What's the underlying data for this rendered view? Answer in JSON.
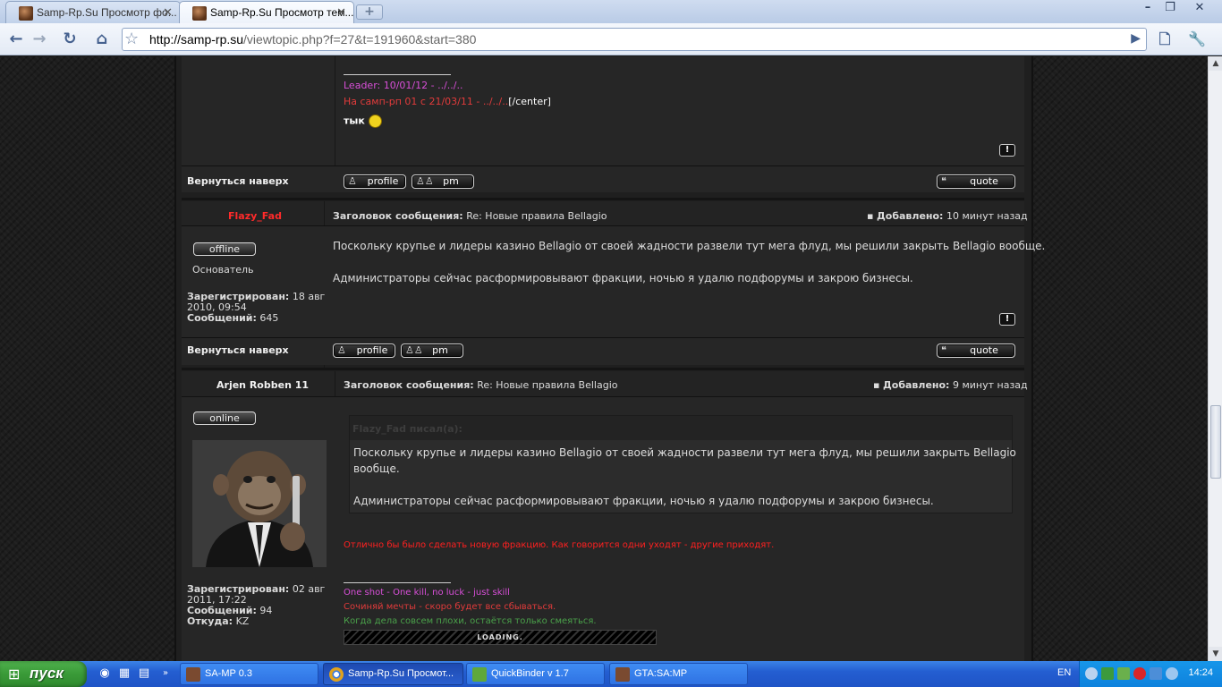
{
  "browser": {
    "tabs": [
      {
        "title": "Samp-Rp.Su Просмотр фо..."
      },
      {
        "title": "Samp-Rp.Su Просмотр тем..."
      }
    ],
    "new_tab_symbol": "+",
    "window_buttons": [
      "–",
      "❐",
      "✕"
    ],
    "url_host": "http://samp-rp.su",
    "url_path": "/viewtopic.php?f=27&t=191960&start=380",
    "icons": [
      "back-icon",
      "forward-icon",
      "reload-icon",
      "home-icon",
      "bookmark-star-icon",
      "go-icon",
      "page-menu-icon",
      "wrench-icon"
    ]
  },
  "post_top": {
    "sig_line1": "Leader: 10/01/12 - ../../..",
    "sig_line2_red": "На самп-рп 01 с 21/03/11 - ../../..",
    "sig_line2_white": "[/center]",
    "sig_line3": "тык",
    "back_to_top": "Вернуться наверх",
    "profile_label": "profile",
    "pm_label": "pm",
    "quote_label": "quote",
    "report_symbol": "!"
  },
  "post1": {
    "author": "Flazy_Fad",
    "author_color": "#ff2a2a",
    "status": "offline",
    "rank": "Основатель",
    "registered_label": "Зарегистрирован:",
    "registered_value": "18 авг",
    "registered_value2": "2010, 09:54",
    "posts_label": "Сообщений:",
    "posts_value": "645",
    "subject_label": "Заголовок сообщения:",
    "subject_value": "Re: Новые правила Bellagio",
    "added_label": "Добавлено:",
    "added_value": "10 минут назад",
    "body_p1": "Поскольку крупье и лидеры казино Bellagio от своей жадности развели тут мега флуд, мы решили закрыть Bellagio вообще.",
    "body_p2": "Администраторы сейчас расформировывают фракции, ночью я удалю подфорумы и закрою бизнесы.",
    "back_to_top": "Вернуться наверх",
    "profile_label": "profile",
    "pm_label": "pm",
    "quote_label": "quote",
    "report_symbol": "!"
  },
  "post2": {
    "author": "Arjen Robben 11",
    "status": "online",
    "registered_label": "Зарегистрирован:",
    "registered_value": "02 авг",
    "registered_value2": "2011, 17:22",
    "posts_label": "Сообщений:",
    "posts_value": "94",
    "from_label": "Откуда:",
    "from_value": "KZ",
    "subject_label": "Заголовок сообщения:",
    "subject_value": "Re: Новые правила Bellagio",
    "added_label": "Добавлено:",
    "added_value": "9 минут назад",
    "quote_author": "Flazy_Fad писал(а):",
    "quote_p1a": "Поскольку крупье и лидеры казино Bellagio от своей жадности развели тут мега флуд, мы решили закрыть Bellagio",
    "quote_p1b": "вообще.",
    "quote_p2": "Администраторы сейчас расформировывают фракции, ночью я удалю подфорумы и закрою бизнесы.",
    "reply": "Отлично бы было сделать новую фракцию. Как говорится одни уходят - другие приходят.",
    "sig1": "One shot - One kill, no luck - just skill",
    "sig2": "Сочиняй мечты - скоро будет все сбываться.",
    "sig3": "Когда дела совсем плохи, остаётся только смеяться.",
    "loading": "LOADING."
  },
  "taskbar": {
    "start_label": "пуск",
    "tasks": [
      {
        "label": "SA-MP 0.3"
      },
      {
        "label": "Samp-Rp.Su Просмот..."
      },
      {
        "label": "QuickBinder v 1.7"
      },
      {
        "label": "GTA:SA:MP"
      }
    ],
    "lang": "EN",
    "clock": "14:24"
  }
}
